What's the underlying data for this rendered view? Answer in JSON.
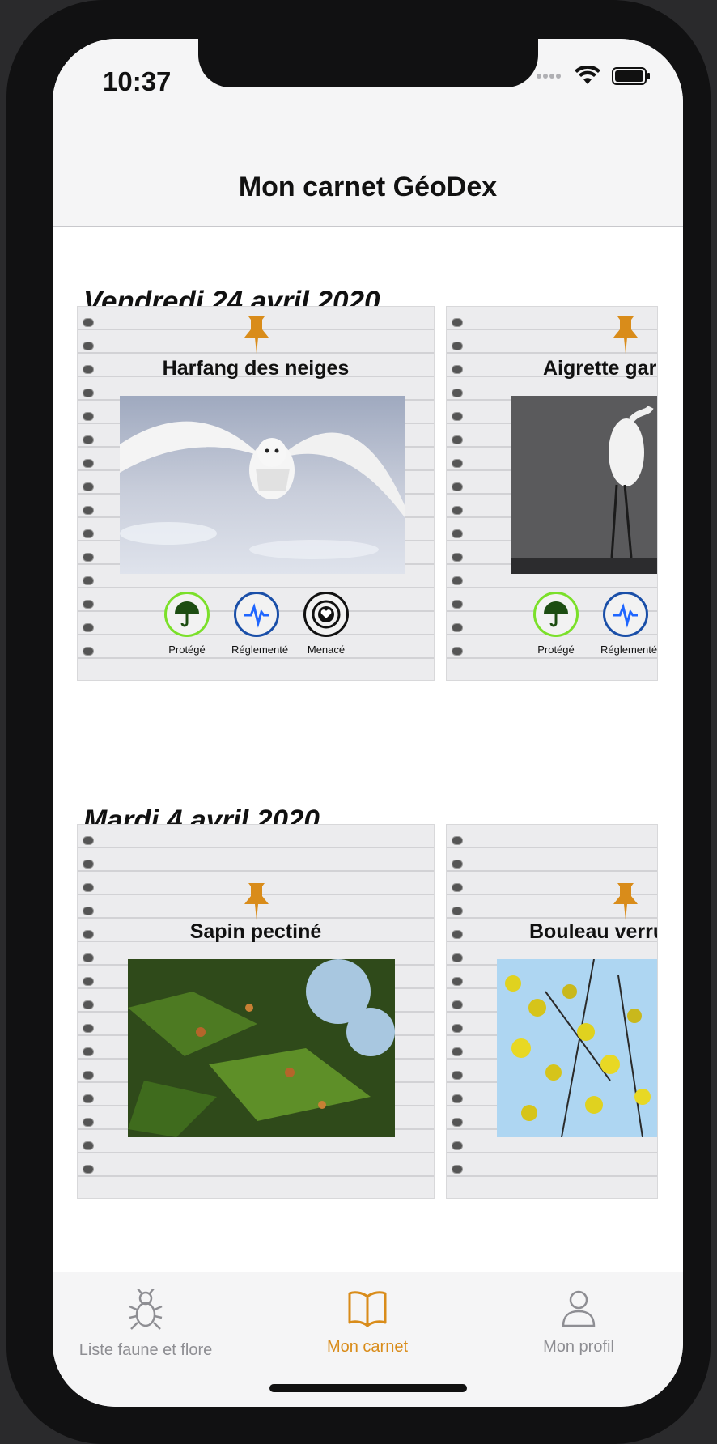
{
  "status": {
    "time": "10:37"
  },
  "nav": {
    "title": "Mon carnet GéoDex"
  },
  "sections": [
    {
      "date": "Vendredi 24 avril 2020",
      "cards": [
        {
          "name": "Harfang des neiges",
          "badges": [
            "Protégé",
            "Réglementé",
            "Menacé"
          ]
        },
        {
          "name": "Aigrette gar",
          "badges": [
            "Protégé",
            "Réglementé"
          ]
        }
      ]
    },
    {
      "date": "Mardi 4 avril 2020",
      "cards": [
        {
          "name": "Sapin pectiné"
        },
        {
          "name": "Bouleau verru"
        }
      ]
    }
  ],
  "tabs": [
    {
      "label": "Liste faune et flore",
      "icon": "bug-icon",
      "active": false
    },
    {
      "label": "Mon carnet",
      "icon": "book-icon",
      "active": true
    },
    {
      "label": "Mon profil",
      "icon": "person-icon",
      "active": false
    }
  ],
  "colors": {
    "accent": "#d98c1a",
    "inactive": "#8e8e93",
    "protected": "#7be02a",
    "regulated": "#1a4fa8",
    "threatened": "#111111"
  }
}
